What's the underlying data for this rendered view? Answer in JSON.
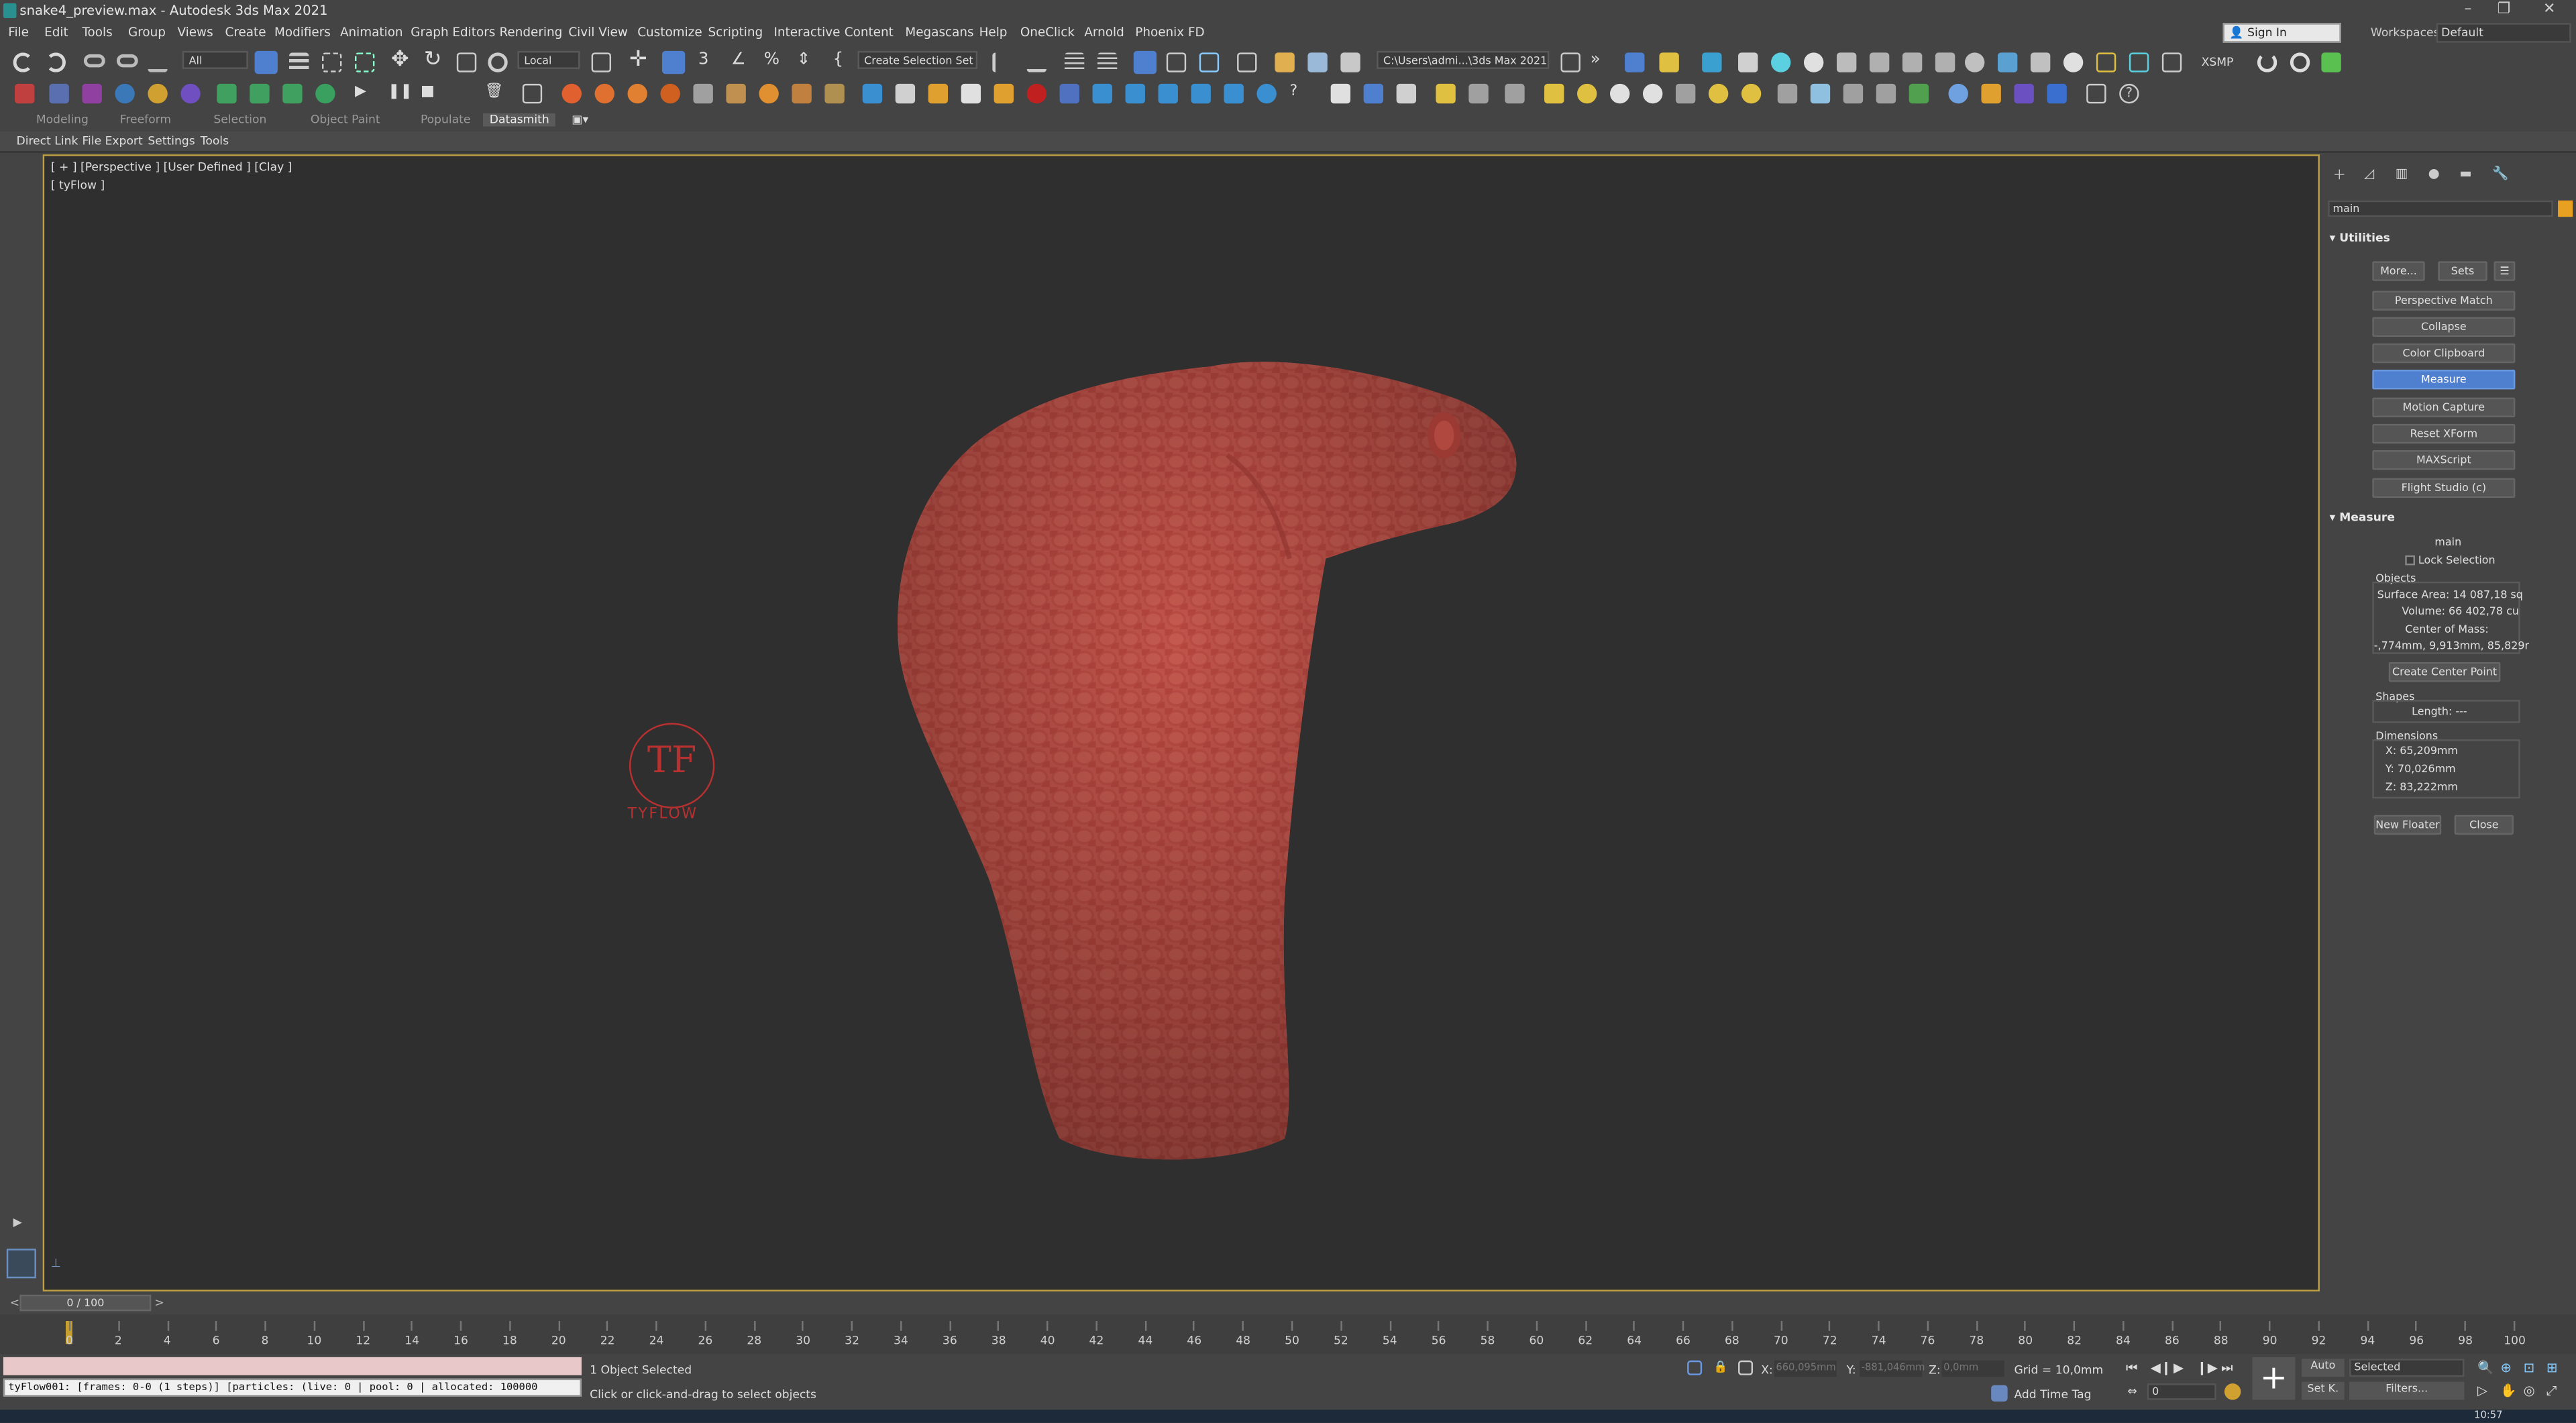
{
  "window": {
    "title": "snake4_preview.max - Autodesk 3ds Max 2021"
  },
  "menu": {
    "items": [
      "File",
      "Edit",
      "Tools",
      "Group",
      "Views",
      "Create",
      "Modifiers",
      "Animation",
      "Graph Editors",
      "Rendering",
      "Civil View",
      "Customize",
      "Scripting",
      "Interactive",
      "Content",
      "Megascans",
      "Help",
      "OneClick",
      "Arnold",
      "Phoenix FD"
    ],
    "sign_in": "Sign In",
    "workspaces_label": "Workspaces:",
    "workspace_value": "Default"
  },
  "toolbar": {
    "filter": "All",
    "coord_system": "Local",
    "selection_set": "Create Selection Set",
    "project_path": "C:\\Users\\admi...\\3ds Max 2021",
    "xsmp": "XSMP"
  },
  "ribbon": {
    "tabs": [
      "Modeling",
      "Freeform",
      "Selection",
      "Object Paint",
      "Populate",
      "Datasmith"
    ],
    "active": "Datasmith"
  },
  "subtabs": [
    "Direct Link",
    "File Export",
    "Settings",
    "Tools"
  ],
  "viewport": {
    "label": "[ + ] [Perspective ] [User Defined ] [Clay ]",
    "sublabel": "[ tyFlow ]",
    "watermark": "TYFLOW",
    "watermark_mono": "TF"
  },
  "command_panel": {
    "name_field": "main",
    "utilities": {
      "title": "Utilities",
      "more": "More...",
      "sets": "Sets",
      "buttons": [
        "Perspective Match",
        "Collapse",
        "Color Clipboard",
        "Measure",
        "Motion Capture",
        "Reset XForm",
        "MAXScript",
        "Flight Studio (c)"
      ],
      "active": "Measure"
    },
    "measure": {
      "title": "Measure",
      "object_name": "main",
      "lock_selection": "Lock Selection",
      "objects_label": "Objects",
      "surface_area": "Surface Area: 14 087,18 sq",
      "volume": "Volume: 66 402,78 cu",
      "center_label": "Center of Mass:",
      "center_value": "-,774mm, 9,913mm, 85,829r",
      "create_center": "Create Center Point",
      "shapes_label": "Shapes",
      "length": "Length: ---",
      "dimensions_label": "Dimensions",
      "dim_x": "X:  65,209mm",
      "dim_y": "Y:  70,026mm",
      "dim_z": "Z:  83,222mm",
      "new_floater": "New Floater",
      "close": "Close"
    }
  },
  "timeline": {
    "frame_counter": "0 / 100",
    "ticks": [
      "0",
      "2",
      "4",
      "6",
      "8",
      "10",
      "12",
      "14",
      "16",
      "18",
      "20",
      "22",
      "24",
      "26",
      "28",
      "30",
      "32",
      "34",
      "36",
      "38",
      "40",
      "42",
      "44",
      "46",
      "48",
      "50",
      "52",
      "54",
      "56",
      "58",
      "60",
      "62",
      "64",
      "66",
      "68",
      "70",
      "72",
      "74",
      "76",
      "78",
      "80",
      "82",
      "84",
      "86",
      "88",
      "90",
      "92",
      "94",
      "96",
      "98",
      "100"
    ]
  },
  "status": {
    "tyflow": "tyFlow001: [frames: 0-0 (1 steps)] [particles: (live: 0 | pool: 0 | allocated: 100000",
    "selected": "1 Object Selected",
    "prompt": "Click or click-and-drag to select objects",
    "x_label": "X:",
    "x_value": "660,095mm",
    "y_label": "Y:",
    "y_value": "-881,046mm",
    "z_label": "Z:",
    "z_value": "0,0mm",
    "grid": "Grid = 10,0mm",
    "add_time_tag": "Add Time Tag",
    "auto": "Auto",
    "set_key": "Set K.",
    "selected_dd": "Selected",
    "filters": "Filters...",
    "frame_field": "0",
    "clock": "10:57"
  }
}
